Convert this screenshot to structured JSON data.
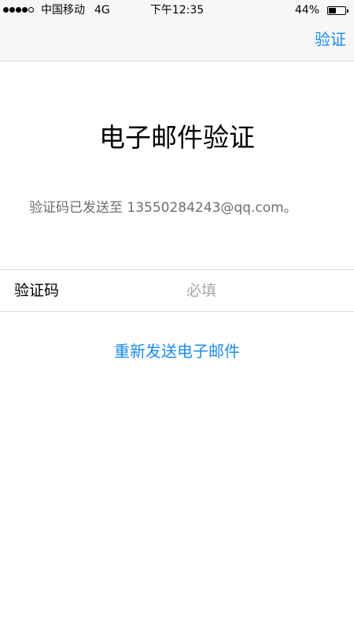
{
  "status_bar": {
    "signal_dots": [
      "filled",
      "filled",
      "filled",
      "filled",
      "empty"
    ],
    "carrier": "中国移动",
    "network": "4G",
    "time": "下午12:35",
    "battery_percent": "44%",
    "battery_level": 0.44
  },
  "nav": {
    "verify_label": "验证"
  },
  "main": {
    "title": "电子邮件验证",
    "sent_message": "验证码已发送至 13550284243@qq.com。",
    "code_label": "验证码",
    "code_placeholder": "必填",
    "code_value": "",
    "resend_label": "重新发送电子邮件"
  },
  "colors": {
    "accent": "#1a8cf0",
    "nav_background": "#f7f7f7",
    "divider": "#d6d6d6",
    "secondary_text": "#6e6e6e",
    "placeholder": "#a8a8a8"
  }
}
